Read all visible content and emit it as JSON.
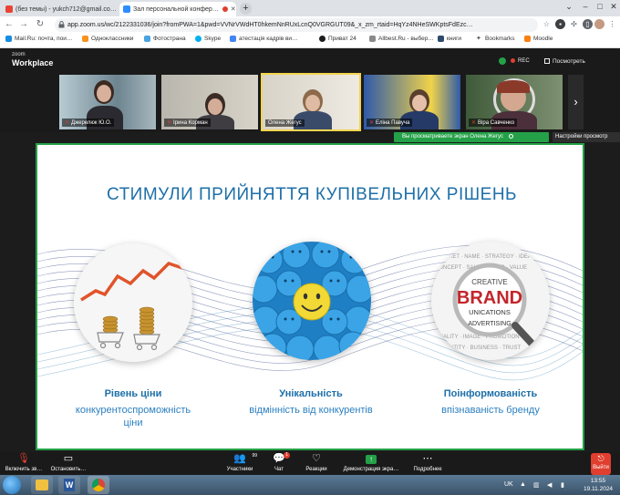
{
  "browser": {
    "tabs": [
      {
        "label": "(без темы) - yukch712@gmail.co…",
        "active": false
      },
      {
        "label": "Зал персональной конфер…",
        "active": true
      }
    ],
    "url": "app.zoom.us/wc/2122331036/join?fromPWA=1&pwd=VVNrVWdHT0hkemNnRUxLcnQ0VGRGUT09&_x_zm_rtaid=HqYz4NHeSWKptsFdEzc…",
    "bookmarks": [
      "Mail.Ru: почта, пои…",
      "Одноклассники",
      "Фотострана",
      "Skype",
      "атестація кадрів ви…",
      "Приват 24",
      "Allbest.Ru - выбер…",
      "книги",
      "Bookmarks",
      "Moodle"
    ]
  },
  "zoom": {
    "logo_top": "zoom",
    "logo_bottom": "Workplace",
    "rec_label": "REC",
    "view_label": "Посмотреть",
    "participants": [
      {
        "name": "Джерелюк Ю.О."
      },
      {
        "name": "Ірина Корман"
      },
      {
        "name": "Олена Жегус"
      },
      {
        "name": "Еліна Павуча"
      },
      {
        "name": "Віра Савченко"
      }
    ],
    "share_banner": "Вы просматриваете экран Олена Жегус",
    "view_options": "Настройки просмотр",
    "toolbar": {
      "mic": "Включить зв…",
      "video": "Остановить…",
      "participants": "Участники",
      "participants_count": "99",
      "chat": "Чат",
      "chat_badge": "1",
      "reactions": "Реакции",
      "share": "Демонстрация экра…",
      "more": "Подробнее",
      "leave": "Выйти"
    }
  },
  "slide": {
    "title": "СТИМУЛИ ПРИЙНЯТТЯ КУПІВЕЛЬНИХ РІШЕНЬ",
    "items": [
      {
        "heading": "Рівень ціни",
        "sub1": "конкурентоспроможність",
        "sub2": "ціни"
      },
      {
        "heading": "Унікальність",
        "sub1": "відмінність від конкурентів",
        "sub2": ""
      },
      {
        "heading": "Поінформованість",
        "sub1": "впізнаваність бренду",
        "sub2": ""
      }
    ],
    "brand_words": {
      "main": "BRAND",
      "creative": "CREATIVE",
      "unications": "UNICATIONS",
      "advertising": "ADVERTISING"
    }
  },
  "taskbar": {
    "lang": "UK",
    "time": "13:55",
    "date": "19.11.2024"
  },
  "colors": {
    "accent_green": "#24a148",
    "slide_blue": "#1d6fa8",
    "leave_red": "#e03e2f"
  }
}
